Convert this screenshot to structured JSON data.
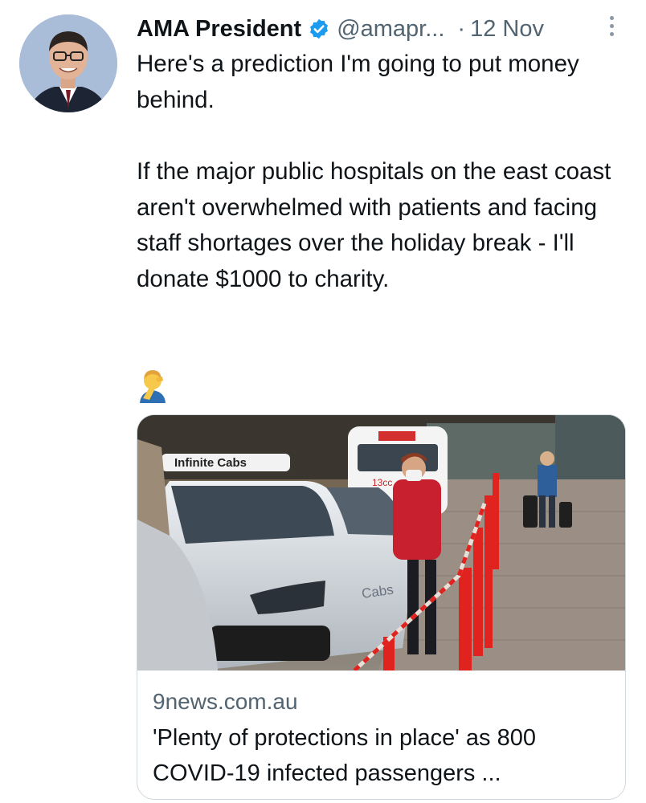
{
  "tweet": {
    "author_name": "AMA President",
    "handle": "@amapr...",
    "separator": "·",
    "date": "12 Nov",
    "paragraph1": "Here's a prediction I'm going to put money behind.",
    "paragraph2": "If the major public hospitals on the east coast aren't overwhelmed with patients and facing staff shortages over the holiday break - I'll donate $1000 to charity.",
    "emoji_name": "man-facepalming-icon"
  },
  "card": {
    "domain": "9news.com.au",
    "title": "'Plenty of protections in place' as 800 COVID-19 infected passengers ...",
    "image_signs": {
      "taxi_sign": "Infinite Cabs",
      "door_text": "Cabs",
      "van_text": "13cc"
    }
  },
  "colors": {
    "text": "#0f1419",
    "secondary": "#536471",
    "verified": "#1d9bf0",
    "border": "#cfd9de"
  }
}
